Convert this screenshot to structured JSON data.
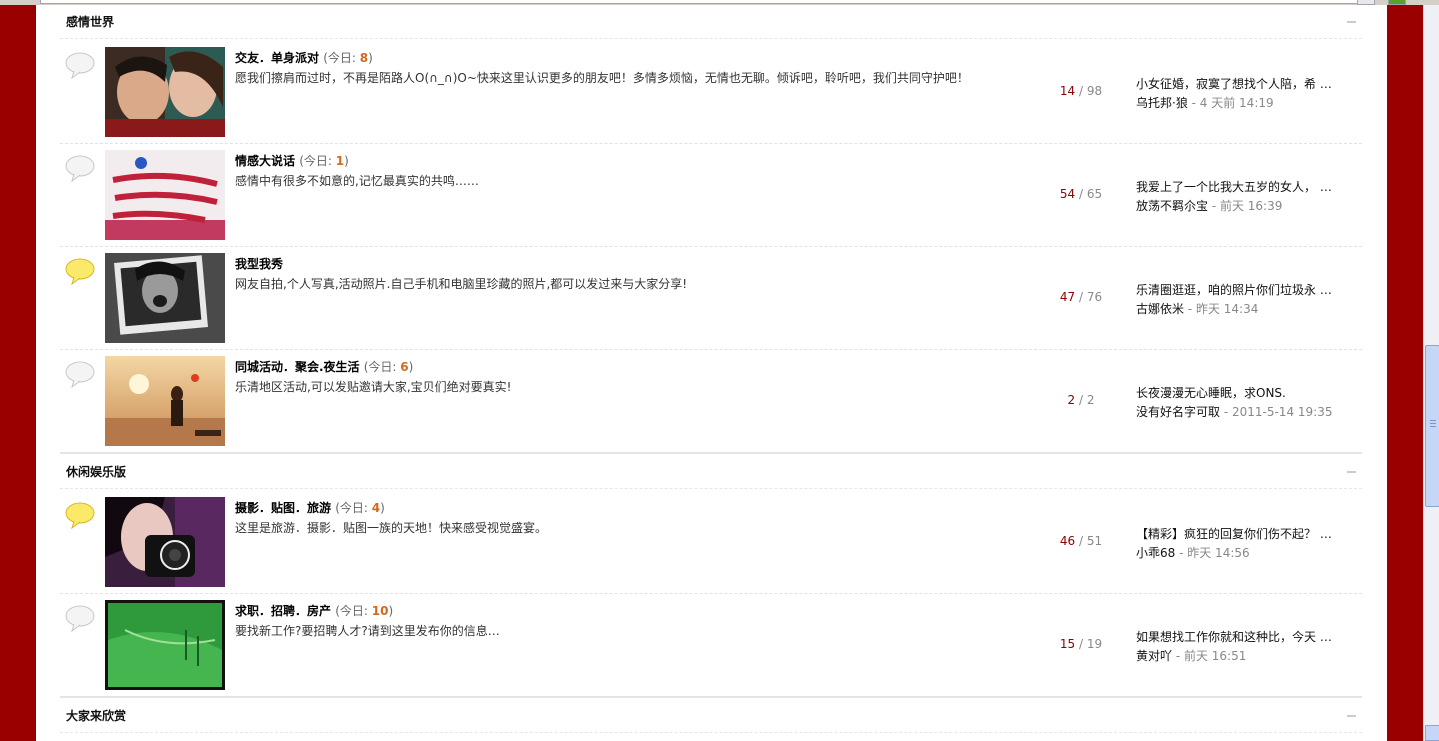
{
  "sections": [
    {
      "title": "感情世界",
      "forums": [
        {
          "name": "交友．单身派对",
          "today_label": "(今日: ",
          "today_count": "8",
          "today_close": ")",
          "desc": "愿我们擦肩而过时，不再是陌路人O(∩_∩)O~快来这里认识更多的朋友吧！多情多烦恼，无情也无聊。倾诉吧，聆听吧，我们共同守护吧！",
          "topics": "14",
          "sep": " / ",
          "posts": "98",
          "last_subject": "小女征婚，寂寞了想找个人陪，希 …",
          "last_author": "乌托邦·狼",
          "last_time": " - 4 天前 14:19",
          "bubble": "grey-bubble-icon"
        },
        {
          "name": "情感大说话",
          "today_label": "(今日: ",
          "today_count": "1",
          "today_close": ")",
          "desc": "感情中有很多不如意的,记忆最真实的共鸣……",
          "topics": "54",
          "sep": " / ",
          "posts": "65",
          "last_subject": "我爱上了一个比我大五岁的女人， …",
          "last_author": "放荡不羁尒宝",
          "last_time": " - 前天 16:39",
          "bubble": "grey-bubble-icon"
        },
        {
          "name": "我型我秀",
          "today_label": "",
          "today_count": "",
          "today_close": "",
          "desc": "网友自拍,个人写真,活动照片.自己手机和电脑里珍藏的照片,都可以发过来与大家分享!",
          "topics": "47",
          "sep": " / ",
          "posts": "76",
          "last_subject": "乐清圈逛逛，咱的照片你们垃圾永 …",
          "last_author": "古娜依米",
          "last_time": " - 昨天 14:34",
          "bubble": "yellow-bubble-icon"
        },
        {
          "name": "同城活动．聚会.夜生活",
          "today_label": "(今日: ",
          "today_count": "6",
          "today_close": ")",
          "desc": "乐清地区活动,可以发贴邀请大家,宝贝们绝对要真实!",
          "topics": "2",
          "sep": " / ",
          "posts": "2",
          "last_subject": "长夜漫漫无心睡眠，求ONS.",
          "last_author": "没有好名字可取",
          "last_time": " - 2011-5-14 19:35",
          "bubble": "grey-bubble-icon"
        }
      ]
    },
    {
      "title": "休闲娱乐版",
      "forums": [
        {
          "name": "摄影．贴图．旅游",
          "today_label": "(今日: ",
          "today_count": "4",
          "today_close": ")",
          "desc": "这里是旅游．摄影．贴图一族的天地！快来感受视觉盛宴。",
          "topics": "46",
          "sep": " / ",
          "posts": "51",
          "last_subject": "【精彩】疯狂的回复你们伤不起？ …",
          "last_author": "小乖68",
          "last_time": " - 昨天 14:56",
          "bubble": "yellow-bubble-icon"
        },
        {
          "name": "求职．招聘．房产",
          "today_label": "(今日: ",
          "today_count": "10",
          "today_close": ")",
          "desc": "要找新工作?要招聘人才?请到这里发布你的信息…",
          "topics": "15",
          "sep": " / ",
          "posts": "19",
          "last_subject": "如果想找工作你就和这种比，今天 …",
          "last_author": "黄对吖",
          "last_time": " - 前天 16:51",
          "bubble": "grey-bubble-icon"
        }
      ]
    },
    {
      "title": "大家来欣赏",
      "forums": []
    }
  ],
  "colors": {
    "page_bg": "#9b0000",
    "today_count": "#d2691e",
    "topics": "#8b0000"
  }
}
